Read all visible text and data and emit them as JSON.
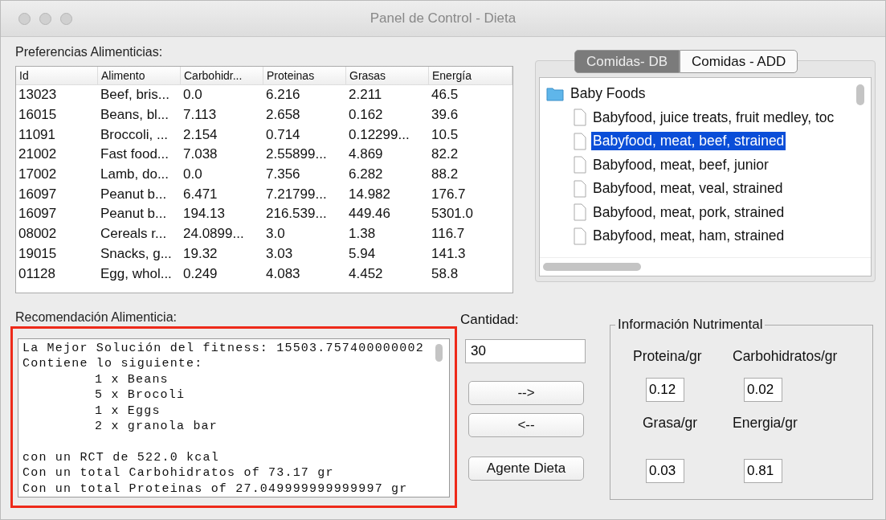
{
  "window": {
    "title": "Panel de Control - Dieta"
  },
  "preferences": {
    "label": "Preferencias Alimenticias:",
    "columns": [
      "Id",
      "Alimento",
      "Carbohidr...",
      "Proteinas",
      "Grasas",
      "Energía"
    ],
    "rows": [
      [
        "13023",
        "Beef, bris...",
        "0.0",
        "6.216",
        "2.211",
        "46.5"
      ],
      [
        "16015",
        "Beans, bl...",
        "7.113",
        "2.658",
        "0.162",
        "39.6"
      ],
      [
        "11091",
        "Broccoli, ...",
        "2.154",
        "0.714",
        "0.12299...",
        "10.5"
      ],
      [
        "21002",
        "Fast food...",
        "7.038",
        "2.55899...",
        "4.869",
        "82.2"
      ],
      [
        "17002",
        "Lamb, do...",
        "0.0",
        "7.356",
        "6.282",
        "88.2"
      ],
      [
        "16097",
        "Peanut b...",
        "6.471",
        "7.21799...",
        "14.982",
        "176.7"
      ],
      [
        "16097",
        "Peanut b...",
        "194.13",
        "216.539...",
        "449.46",
        "5301.0"
      ],
      [
        "08002",
        "Cereals r...",
        "24.0899...",
        "3.0",
        "1.38",
        "116.7"
      ],
      [
        "19015",
        "Snacks, g...",
        "19.32",
        "3.03",
        "5.94",
        "141.3"
      ],
      [
        "01128",
        "Egg, whol...",
        "0.249",
        "4.083",
        "4.452",
        "58.8"
      ]
    ]
  },
  "tabs": [
    {
      "label": "Comidas- DB",
      "selected": true
    },
    {
      "label": "Comidas - ADD",
      "selected": false
    }
  ],
  "tree": [
    {
      "label": "Baby Foods",
      "kind": "folder",
      "selected": false,
      "children": [
        {
          "label": "Babyfood, juice treats, fruit medley, toc",
          "kind": "file",
          "selected": false
        },
        {
          "label": "Babyfood, meat, beef, strained",
          "kind": "file",
          "selected": true
        },
        {
          "label": "Babyfood, meat, beef, junior",
          "kind": "file",
          "selected": false
        },
        {
          "label": "Babyfood, meat, veal, strained",
          "kind": "file",
          "selected": false
        },
        {
          "label": "Babyfood, meat, pork, strained",
          "kind": "file",
          "selected": false
        },
        {
          "label": "Babyfood, meat, ham, strained",
          "kind": "file",
          "selected": false
        }
      ]
    }
  ],
  "recommendation": {
    "label": "Recomendación Alimenticia:",
    "highlighted": true,
    "summary": [
      "La Mejor Solución del fitness: 15503.757400000002",
      "Contiene lo siguiente:"
    ],
    "items": [
      "1 x Beans",
      "5 x Brocoli",
      "1 x Eggs",
      "2 x granola bar"
    ],
    "totals": [
      "con un RCT de 522.0 kcal",
      "Con un total Carbohidratos of 73.17 gr",
      "Con un total Proteinas of 27.049999999999997 gr"
    ]
  },
  "quantity": {
    "label": "Cantidad:",
    "value": "30"
  },
  "buttons": [
    "-->",
    "<--",
    "Agente Dieta"
  ],
  "nutrition": {
    "title": "Información Nutrimental",
    "fields": [
      {
        "label": "Proteina/gr",
        "value": "0.12"
      },
      {
        "label": "Carbohidratos/gr",
        "value": "0.02"
      },
      {
        "label": "Grasa/gr",
        "value": "0.03"
      },
      {
        "label": "Energia/gr",
        "value": "0.81"
      }
    ]
  }
}
